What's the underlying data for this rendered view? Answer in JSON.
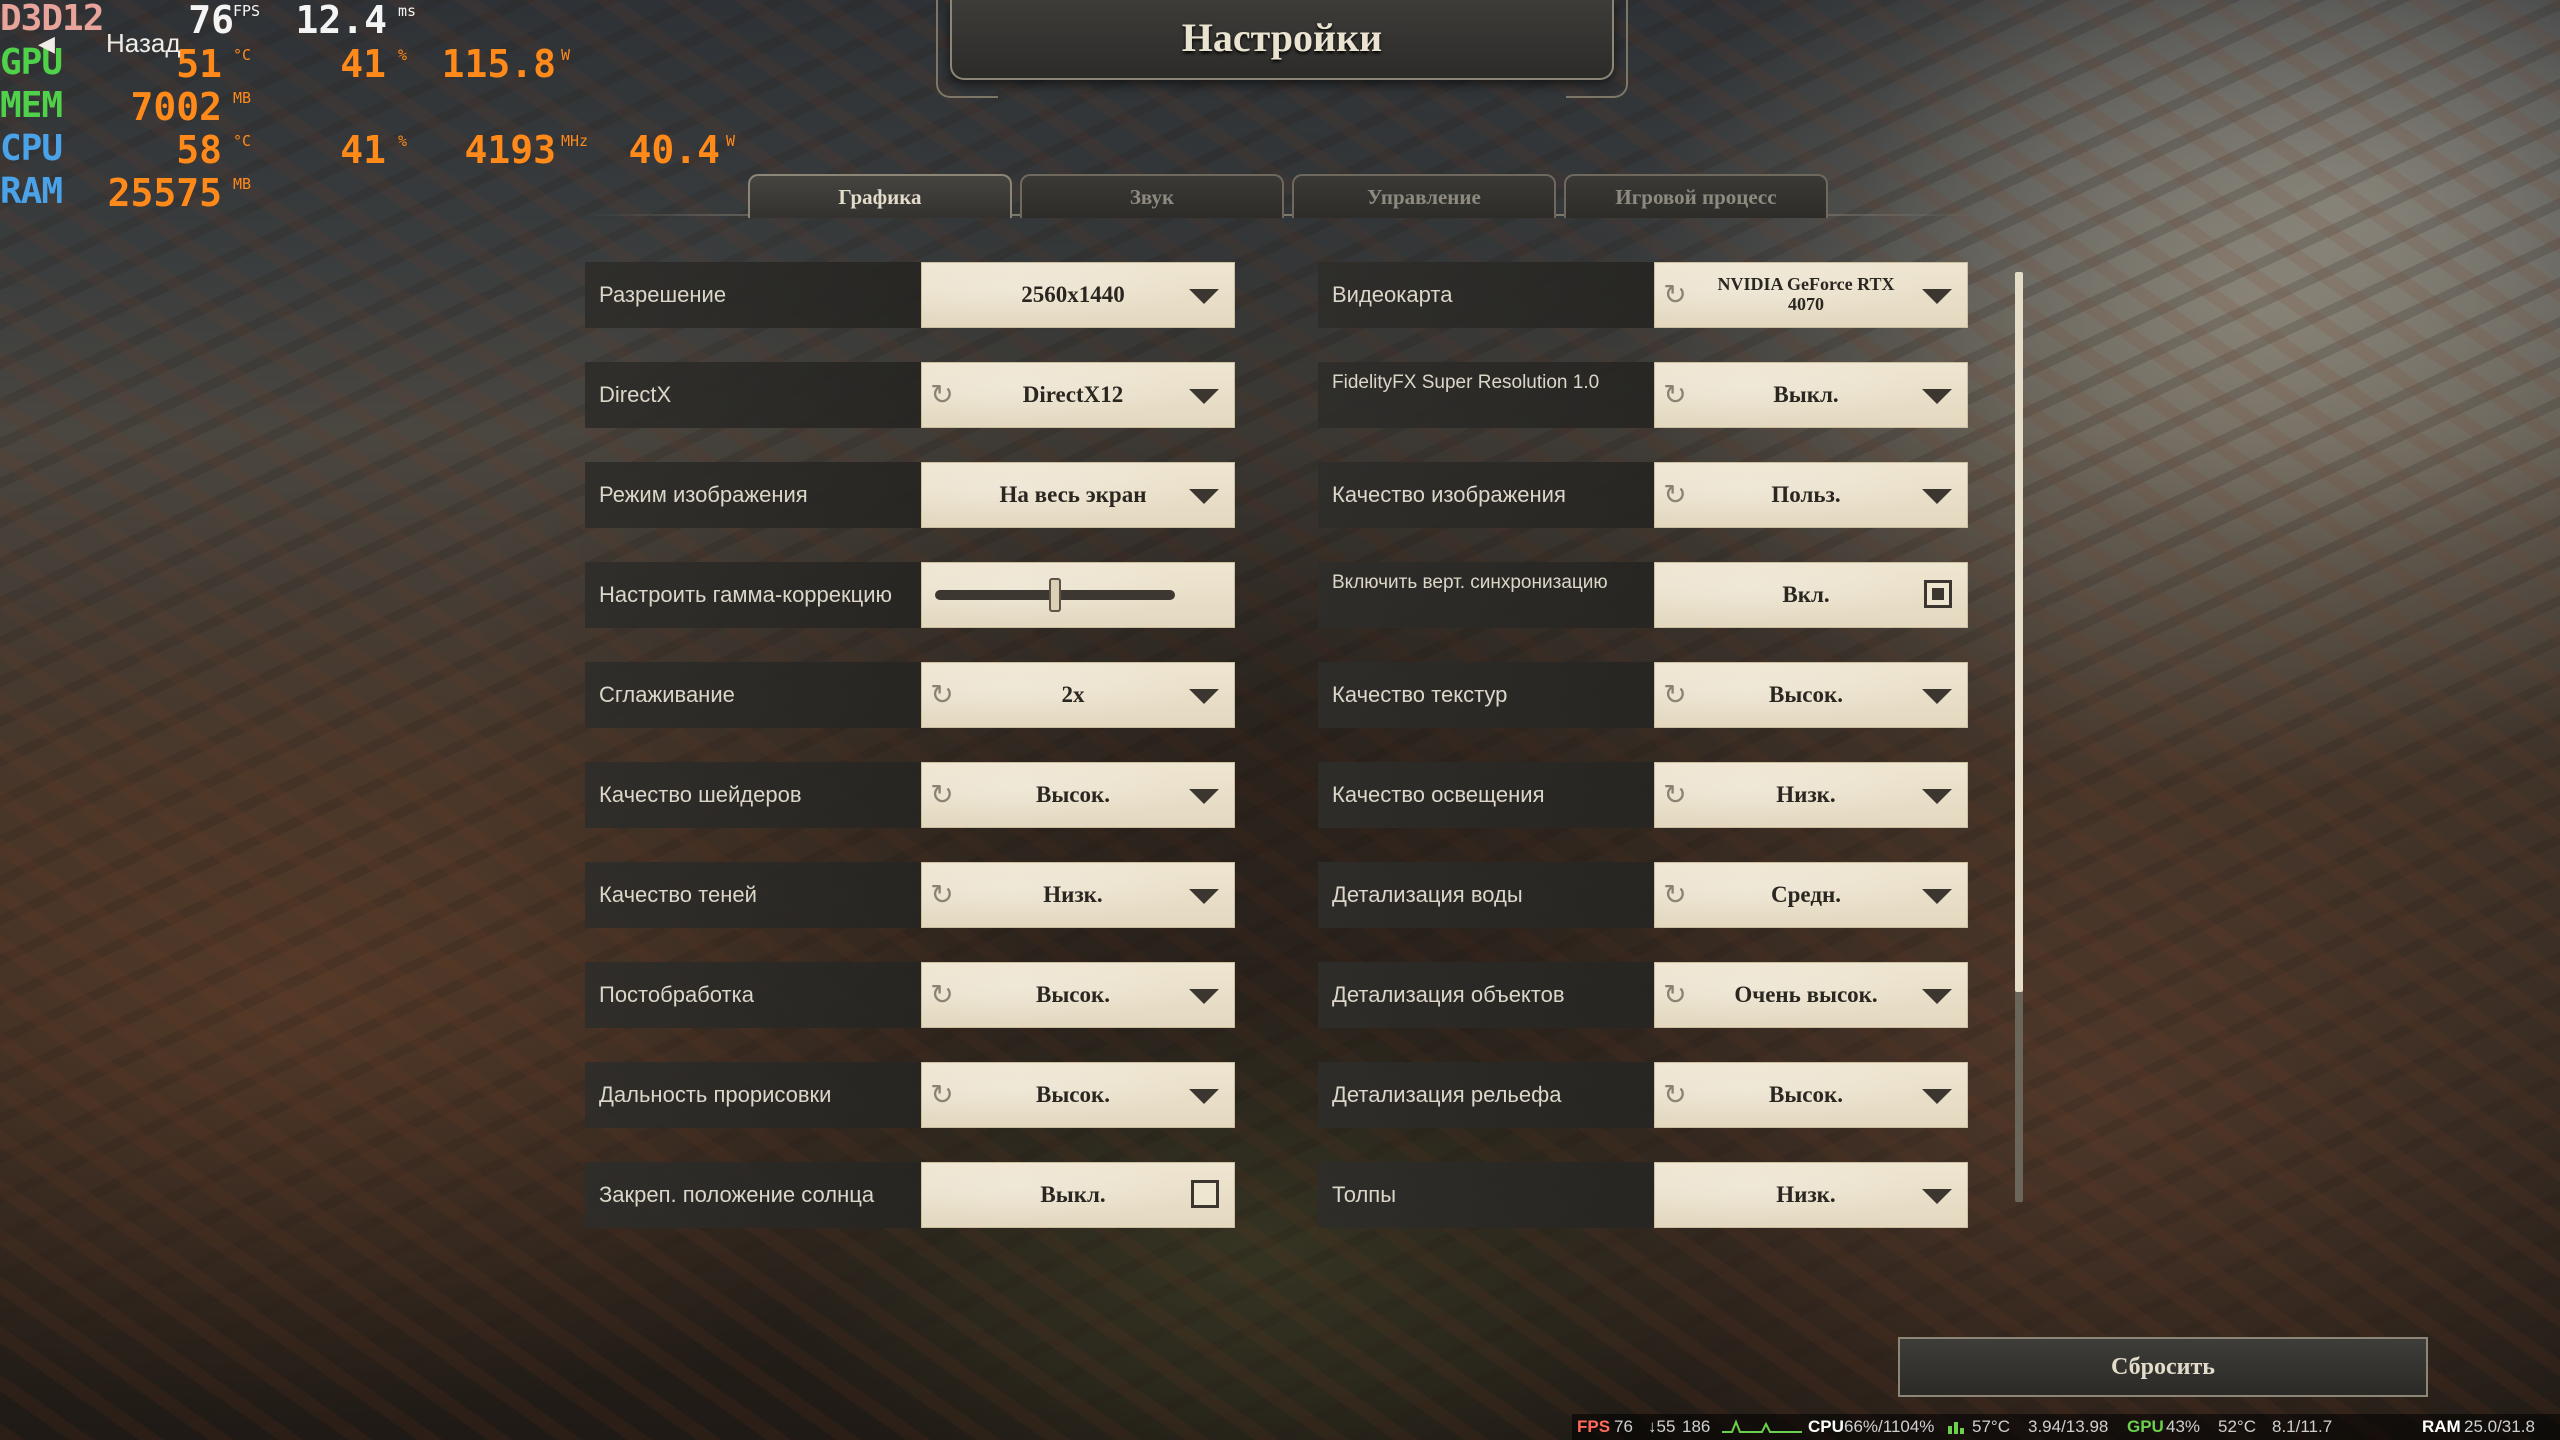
{
  "osd": {
    "rows": [
      {
        "key": "D3D12",
        "val1": "76",
        "unit1": "FPS",
        "val2": "12.4",
        "unit2": "ms"
      },
      {
        "key": "GPU",
        "val1": "51",
        "unit1": "°C",
        "val2": "41",
        "unit2": "%",
        "val3": "115.8",
        "unit3": "W"
      },
      {
        "key": "MEM",
        "val1": "7002",
        "unit1": "MB"
      },
      {
        "key": "CPU",
        "val1": "58",
        "unit1": "°C",
        "val2": "41",
        "unit2": "%",
        "val3": "4193",
        "unit3": "MHz",
        "val4": "40.4",
        "unit4": "W"
      },
      {
        "key": "RAM",
        "val1": "25575",
        "unit1": "MB"
      }
    ]
  },
  "header": {
    "back_label": "Назад",
    "title": "Настройки"
  },
  "tabs": [
    {
      "label": "Графика",
      "active": true
    },
    {
      "label": "Звук",
      "active": false
    },
    {
      "label": "Управление",
      "active": false
    },
    {
      "label": "Игровой процесс",
      "active": false
    }
  ],
  "settings": {
    "left": [
      {
        "label": "Разрешение",
        "value": "2560x1440",
        "control": "dropdown",
        "resettable": false
      },
      {
        "label": "DirectX",
        "value": "DirectX12",
        "control": "dropdown",
        "resettable": true
      },
      {
        "label": "Режим изображения",
        "value": "На весь экран",
        "control": "dropdown",
        "resettable": false
      },
      {
        "label": "Настроить гамма-коррекцию",
        "value": "",
        "control": "slider",
        "slider_level": 0.5
      },
      {
        "label": "Сглаживание",
        "value": "2x",
        "control": "dropdown",
        "resettable": true
      },
      {
        "label": "Качество шейдеров",
        "value": "Высок.",
        "control": "dropdown",
        "resettable": true
      },
      {
        "label": "Качество теней",
        "value": "Низк.",
        "control": "dropdown",
        "resettable": true
      },
      {
        "label": "Постобработка",
        "value": "Высок.",
        "control": "dropdown",
        "resettable": true
      },
      {
        "label": "Дальность прорисовки",
        "value": "Высок.",
        "control": "dropdown",
        "resettable": true
      },
      {
        "label": "Закреп. положение солнца",
        "value": "Выкл.",
        "control": "checkbox",
        "checked": false
      }
    ],
    "right": [
      {
        "label": "Видеокарта",
        "value_line1": "NVIDIA GeForce RTX",
        "value_line2": "4070",
        "control": "dropdown",
        "resettable": true
      },
      {
        "label": "FidelityFX Super Resolution 1.0",
        "value": "Выкл.",
        "control": "dropdown",
        "resettable": true
      },
      {
        "label": "Качество изображения",
        "value": "Польз.",
        "control": "dropdown",
        "resettable": true
      },
      {
        "label": "Включить верт. синхронизацию",
        "value": "Вкл.",
        "control": "checkbox",
        "checked": true
      },
      {
        "label": "Качество текстур",
        "value": "Высок.",
        "control": "dropdown",
        "resettable": true
      },
      {
        "label": "Качество освещения",
        "value": "Низк.",
        "control": "dropdown",
        "resettable": true
      },
      {
        "label": "Детализация воды",
        "value": "Средн.",
        "control": "dropdown",
        "resettable": true
      },
      {
        "label": "Детализация объектов",
        "value": "Очень высок.",
        "control": "dropdown",
        "resettable": true
      },
      {
        "label": "Детализация рельефа",
        "value": "Высок.",
        "control": "dropdown",
        "resettable": true
      },
      {
        "label": "Толпы",
        "value": "Низк.",
        "control": "dropdown",
        "resettable": false
      }
    ]
  },
  "footer": {
    "reset_label": "Сбросить"
  },
  "statusbar": {
    "fps_label": "FPS",
    "fps_value": "76",
    "fps_low": "↓55",
    "fps_extra": "186",
    "cpu_label": "CPU",
    "cpu_value": "66%/1104%",
    "temp1": "57°C",
    "gpu_mem": "3.94/13.98",
    "gpu_label": "GPU",
    "gpu_value": "43%",
    "temp2": "52°C",
    "vram": "8.1/11.7",
    "ram_label": "RAM",
    "ram_value": "25.0/31.8"
  },
  "colors": {
    "panel_bg": "#2e2d2a",
    "control_bg": "#efe6d2",
    "accent_text": "#e3dccb",
    "osd_green": "#4fd24a",
    "osd_blue": "#4aa2e8",
    "osd_orange": "#ff8a1a",
    "osd_pink": "#e8a39a"
  }
}
